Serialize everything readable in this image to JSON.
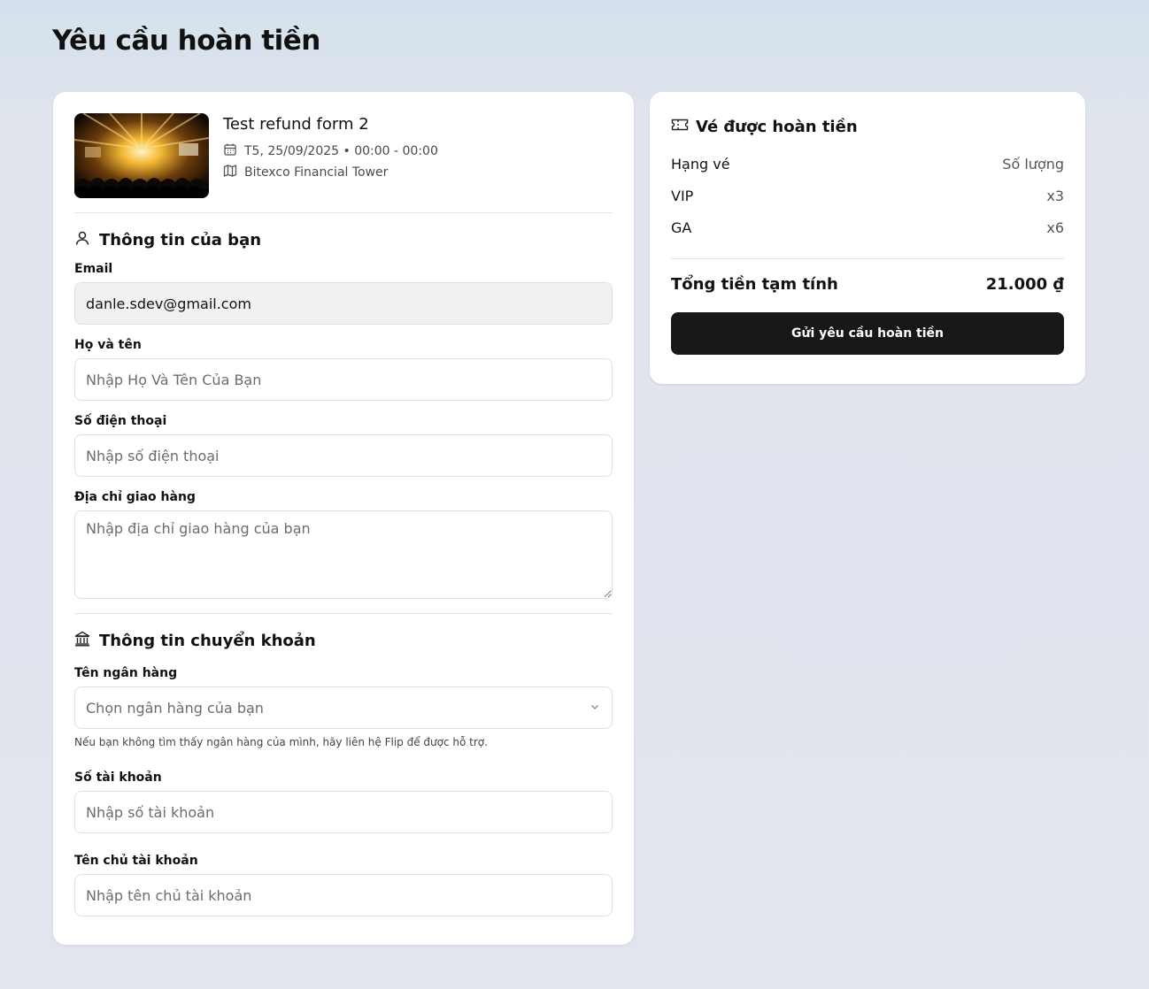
{
  "page": {
    "title": "Yêu cầu hoàn tiền"
  },
  "event": {
    "name": "Test refund form 2",
    "datetime": "T5, 25/09/2025 • 00:00 - 00:00",
    "venue": "Bitexco Financial Tower"
  },
  "personal": {
    "heading": "Thông tin của bạn",
    "email_label": "Email",
    "email_value": "danle.sdev@gmail.com",
    "name_label": "Họ và tên",
    "name_placeholder": "Nhập Họ Và Tên Của Bạn",
    "phone_label": "Số điện thoại",
    "phone_placeholder": "Nhập số điện thoại",
    "address_label": "Địa chỉ giao hàng",
    "address_placeholder": "Nhập địa chỉ giao hàng của bạn"
  },
  "bank": {
    "heading": "Thông tin chuyển khoản",
    "bank_label": "Tên ngân hàng",
    "bank_placeholder": "Chọn ngân hàng của bạn",
    "bank_hint": "Nếu bạn không tìm thấy ngân hàng của mình, hãy liên hệ Flip để được hỗ trợ.",
    "account_label": "Số tài khoản",
    "account_placeholder": "Nhập số tài khoản",
    "holder_label": "Tên chủ tài khoản",
    "holder_placeholder": "Nhập tên chủ tài khoản"
  },
  "summary": {
    "heading": "Vé được hoàn tiền",
    "col_type": "Hạng vé",
    "col_qty": "Số lượng",
    "tickets": [
      {
        "type": "VIP",
        "qty": "x3"
      },
      {
        "type": "GA",
        "qty": "x6"
      }
    ],
    "total_label": "Tổng tiền tạm tính",
    "total_value": "21.000 ₫",
    "submit_label": "Gửi yêu cầu hoàn tiền"
  },
  "icons": [
    "calendar-icon",
    "map-icon",
    "user-icon",
    "bank-icon",
    "chevron-down-icon",
    "ticket-icon"
  ]
}
